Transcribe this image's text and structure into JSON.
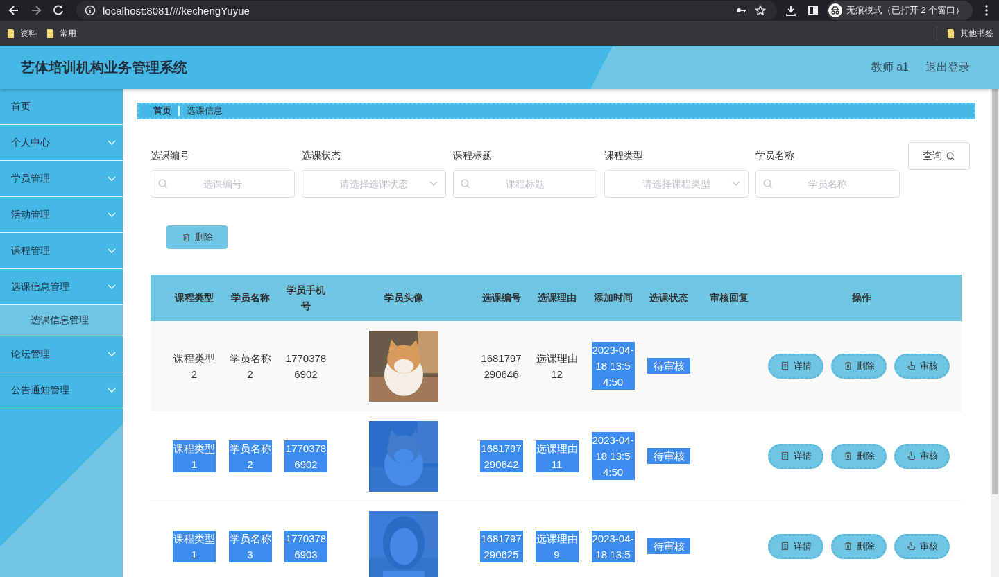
{
  "browser": {
    "url": "localhost:8081/#/kechengYuyue",
    "incognito": "无痕模式（已打开 2 个窗口）",
    "bookmarks": [
      "资料",
      "常用"
    ],
    "other_bookmarks": "其他书签"
  },
  "header": {
    "title": "艺体培训机构业务管理系统",
    "user": "教师 a1",
    "logout": "退出登录"
  },
  "sidebar": {
    "items": [
      {
        "label": "首页",
        "expandable": false
      },
      {
        "label": "个人中心",
        "expandable": true
      },
      {
        "label": "学员管理",
        "expandable": true
      },
      {
        "label": "活动管理",
        "expandable": true
      },
      {
        "label": "课程管理",
        "expandable": true
      },
      {
        "label": "选课信息管理",
        "expandable": true,
        "children": [
          {
            "label": "选课信息管理",
            "selected": true
          }
        ]
      },
      {
        "label": "论坛管理",
        "expandable": true
      },
      {
        "label": "公告通知管理",
        "expandable": true
      }
    ]
  },
  "breadcrumb": {
    "home": "首页",
    "current": "选课信息"
  },
  "filters": [
    {
      "label": "选课编号",
      "kind": "input",
      "placeholder": "选课编号"
    },
    {
      "label": "选课状态",
      "kind": "select",
      "placeholder": "请选择选课状态"
    },
    {
      "label": "课程标题",
      "kind": "input",
      "placeholder": "课程标题"
    },
    {
      "label": "课程类型",
      "kind": "select",
      "placeholder": "请选择课程类型"
    },
    {
      "label": "学员名称",
      "kind": "input",
      "placeholder": "学员名称"
    }
  ],
  "search_button": "查询",
  "delete_button": "删除",
  "table": {
    "columns": [
      "课程类型",
      "学员名称",
      "学员手机号",
      "学员头像",
      "选课编号",
      "选课理由",
      "添加时间",
      "选课状态",
      "审核回复",
      "操作"
    ],
    "rows": [
      {
        "course_type": {
          "text": "课程类型2",
          "highlighted": false
        },
        "student_name": {
          "text": "学员名称2",
          "highlighted": false
        },
        "phone": {
          "text": "17703786902",
          "highlighted": false
        },
        "avatar": {
          "kind": "picture",
          "highlighted": false
        },
        "number": {
          "text": "1681797290646",
          "highlighted": false
        },
        "reason": {
          "text": "选课理由12",
          "highlighted": false
        },
        "time": {
          "text": "2023-04-18 13:54:50",
          "highlighted": true
        },
        "status": {
          "text": "待审核",
          "highlighted": true
        },
        "actions": [
          {
            "label": "详情",
            "kind": "detail"
          },
          {
            "label": "删除",
            "kind": "delete"
          },
          {
            "label": "审核",
            "kind": "audit"
          }
        ]
      },
      {
        "course_type": {
          "text": "课程类型1",
          "highlighted": true
        },
        "student_name": {
          "text": "学员名称2",
          "highlighted": true
        },
        "phone": {
          "text": "17703786902",
          "highlighted": true
        },
        "avatar": {
          "kind": "picture",
          "highlighted": true
        },
        "number": {
          "text": "1681797290642",
          "highlighted": true
        },
        "reason": {
          "text": "选课理由11",
          "highlighted": true
        },
        "time": {
          "text": "2023-04-18 13:54:50",
          "highlighted": true
        },
        "status": {
          "text": "待审核",
          "highlighted": true
        },
        "actions": [
          {
            "label": "详情",
            "kind": "detail"
          },
          {
            "label": "删除",
            "kind": "delete"
          },
          {
            "label": "审核",
            "kind": "audit"
          }
        ]
      },
      {
        "course_type": {
          "text": "课程类型1",
          "highlighted": true
        },
        "student_name": {
          "text": "学员名称3",
          "highlighted": true
        },
        "phone": {
          "text": "17703786903",
          "highlighted": true
        },
        "avatar": {
          "kind": "picture",
          "highlighted": true
        },
        "number": {
          "text": "1681797290625",
          "highlighted": true
        },
        "reason": {
          "text": "选课理由9",
          "highlighted": true
        },
        "time": {
          "text": "2023-04-18 13:5",
          "highlighted": true
        },
        "status": {
          "text": "待审核",
          "highlighted": true
        },
        "actions": [
          {
            "label": "详情",
            "kind": "detail"
          },
          {
            "label": "删除",
            "kind": "delete"
          },
          {
            "label": "审核",
            "kind": "audit"
          }
        ]
      }
    ]
  }
}
